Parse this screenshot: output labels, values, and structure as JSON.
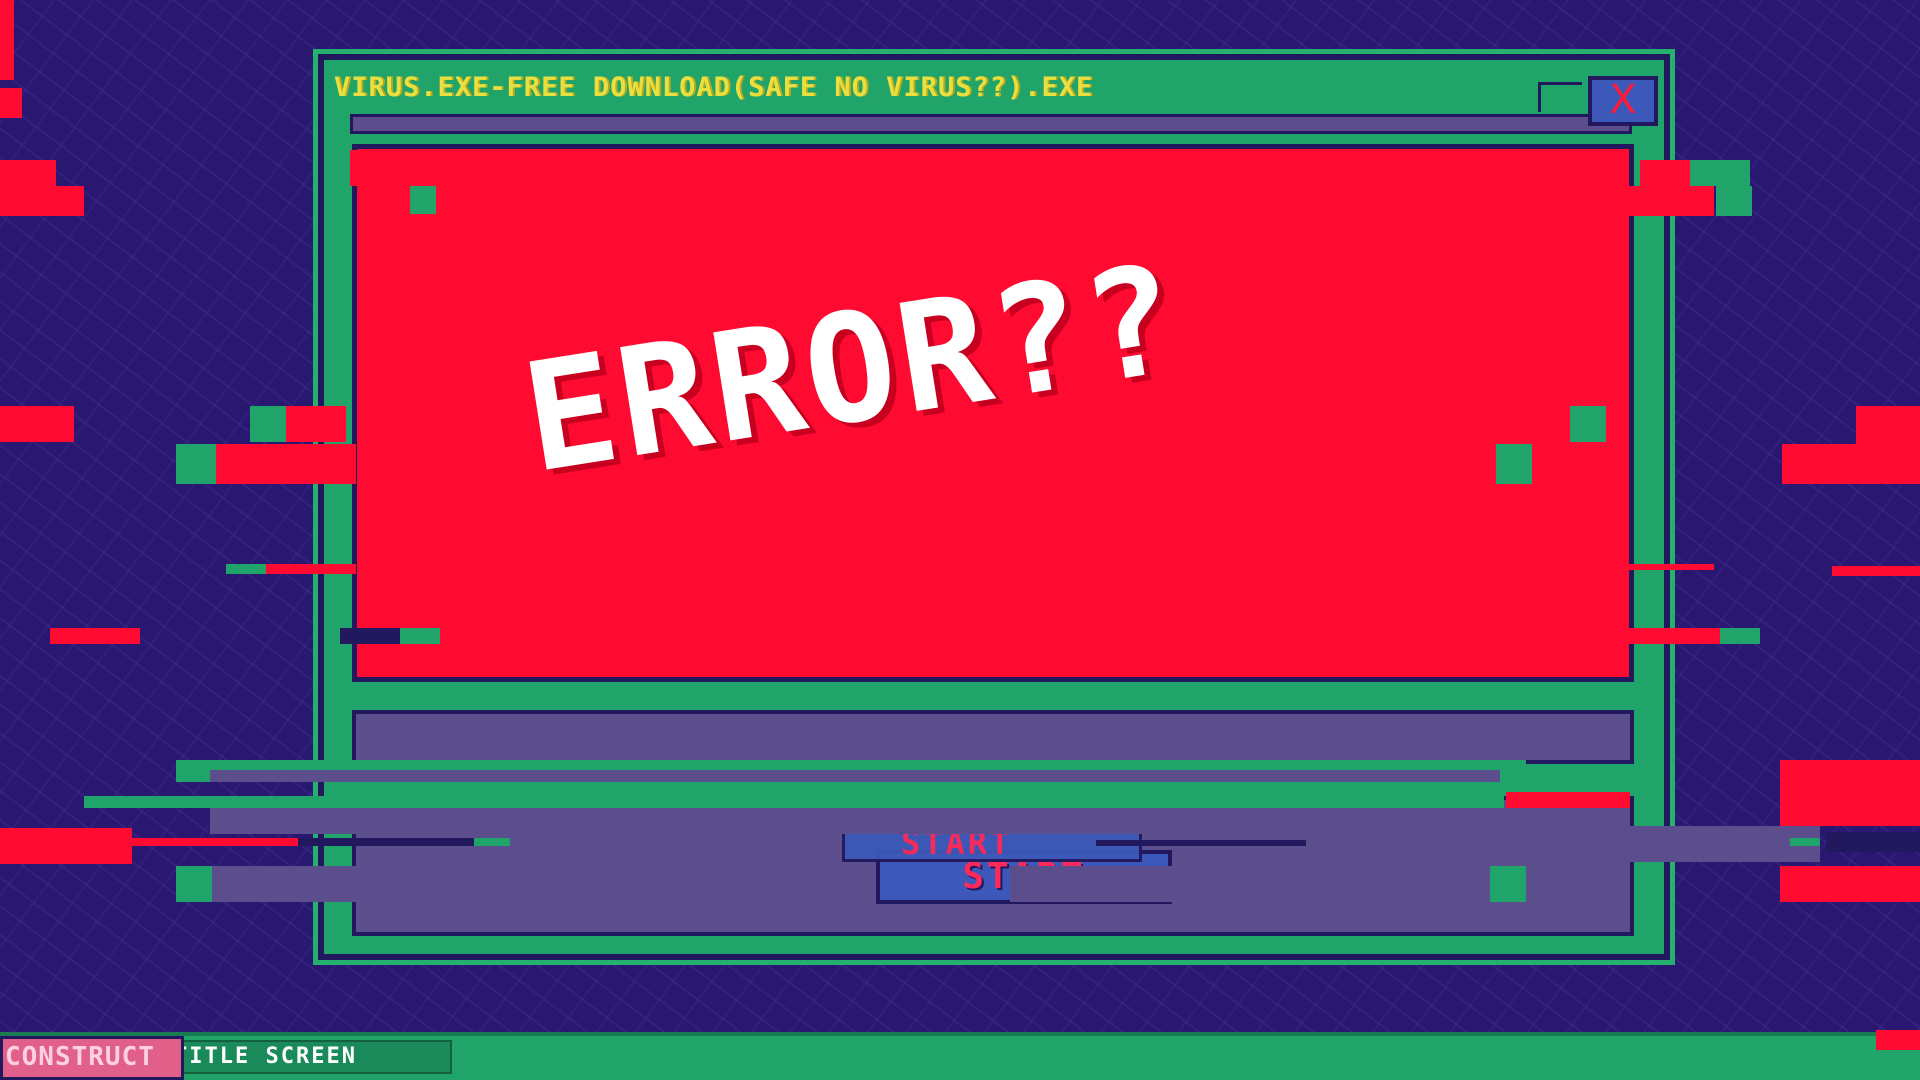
{
  "window": {
    "title": "VIRUS.EXE-FREE DOWNLOAD(SAFE NO VIRUS??).EXE",
    "close_label": "X"
  },
  "error": {
    "message": "ERROR??"
  },
  "start_button": {
    "label": "START"
  },
  "taskbar": {
    "start_label": "CONSTRUCT",
    "task_item_label": "TITLE SCREEN"
  },
  "colors": {
    "background": "#2a1870",
    "window_frame": "#20a46a",
    "error_panel": "#ff0a30",
    "title_text": "#e8e040",
    "start_text": "#ff2a5a",
    "field": "#5c4e8c",
    "button": "#3c58b8"
  }
}
